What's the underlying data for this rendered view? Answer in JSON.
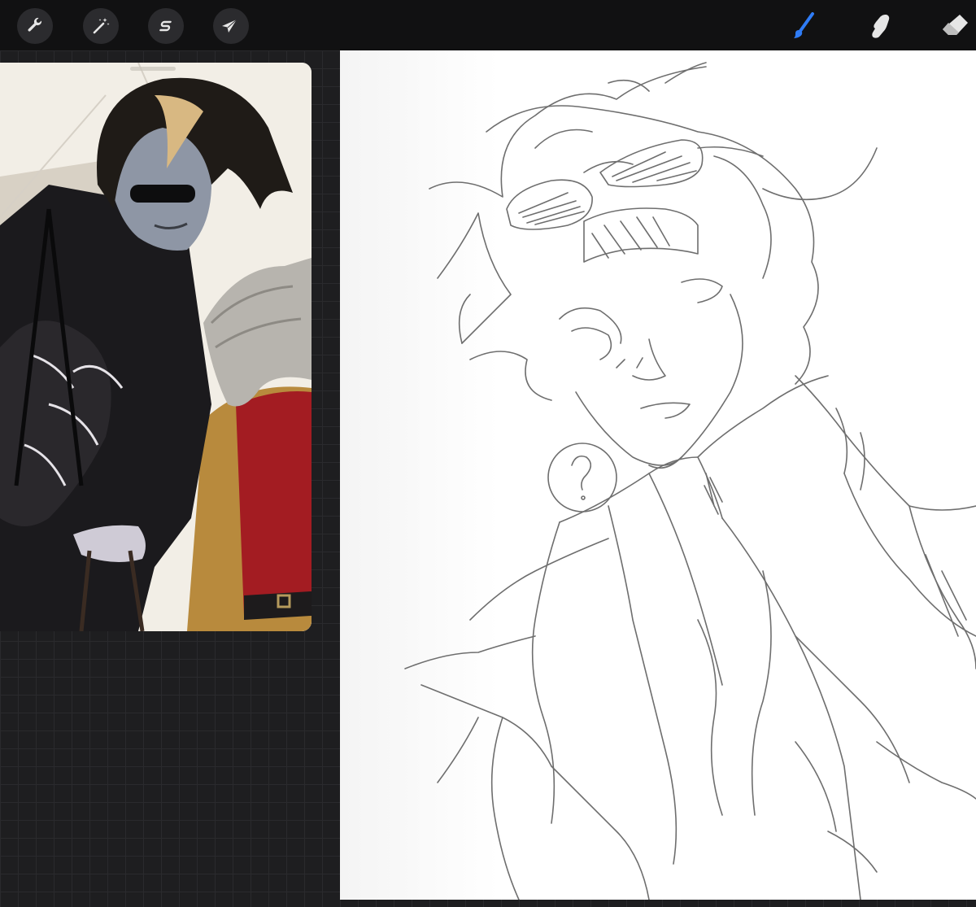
{
  "toolbar": {
    "left_tools": [
      {
        "name": "actions",
        "icon": "wrench-icon"
      },
      {
        "name": "adjustments",
        "icon": "magic-wand-icon"
      },
      {
        "name": "selection",
        "icon": "selection-s-icon"
      },
      {
        "name": "transform",
        "icon": "arrow-cursor-icon"
      }
    ],
    "right_tools": [
      {
        "name": "brush",
        "icon": "brush-icon",
        "active": true
      },
      {
        "name": "smudge",
        "icon": "smudge-finger-icon",
        "active": false
      },
      {
        "name": "eraser",
        "icon": "eraser-icon",
        "active": false
      }
    ],
    "active_color": "#2f7cf6"
  },
  "reference_window": {
    "description_icon": "reference-image"
  },
  "canvas": {
    "sketch_glyph": "?"
  }
}
